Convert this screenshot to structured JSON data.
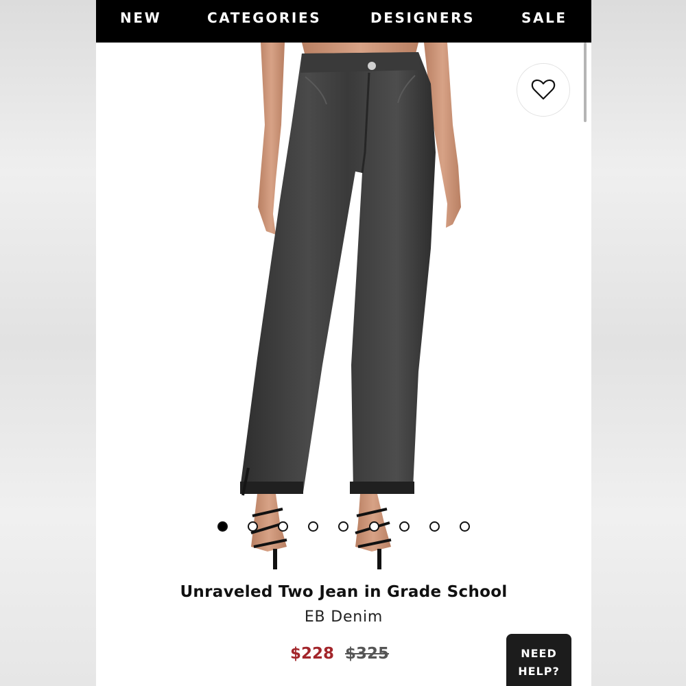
{
  "nav": {
    "items": [
      {
        "label": "NEW"
      },
      {
        "label": "CATEGORIES"
      },
      {
        "label": "DESIGNERS"
      },
      {
        "label": "SALE"
      }
    ]
  },
  "product": {
    "image_alt": "Model wearing dark washed straight-leg jeans with released hems and black strappy heels",
    "title": "Unraveled Two Jean in Grade School",
    "brand": "EB Denim",
    "price_sale": "$228",
    "price_original": "$325",
    "wishlist_icon": "heart-icon"
  },
  "carousel": {
    "total_images": 9,
    "active_index": 0
  },
  "help": {
    "line1": "NEED",
    "line2": "HELP?"
  },
  "colors": {
    "nav_background": "#000000",
    "sale_price": "#a3262b",
    "help_background": "#1c1c1c"
  }
}
